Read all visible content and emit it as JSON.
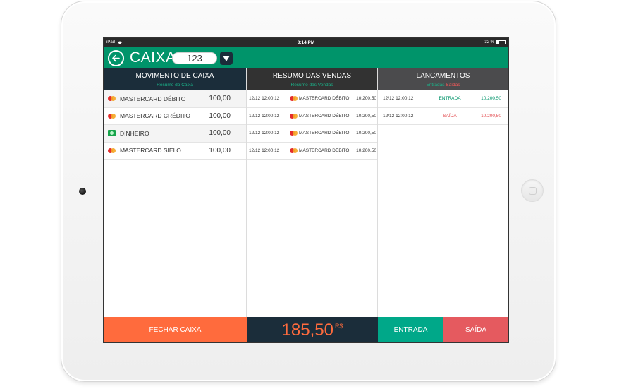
{
  "status_bar": {
    "carrier": "iPad",
    "time": "3:14 PM",
    "battery": "32 %"
  },
  "header": {
    "title": "CAIXA",
    "caixa_number": "123"
  },
  "movimento": {
    "title": "MOVIMENTO DE CAIXA",
    "subtitle": "Resumo do Caixa",
    "items": [
      {
        "icon": "mastercard-icon",
        "label": "MASTERCARD DÉBITO",
        "value": "100,00"
      },
      {
        "icon": "mastercard-icon",
        "label": "MASTERCARD CRÉDITO",
        "value": "100,00"
      },
      {
        "icon": "cash-icon",
        "label": "DINHEIRO",
        "value": "100,00"
      },
      {
        "icon": "mastercard-icon",
        "label": "MASTERCARD SIELO",
        "value": "100,00"
      }
    ]
  },
  "vendas": {
    "title": "RESUMO DAS VENDAS",
    "subtitle": "Resumo das Vendas",
    "items": [
      {
        "date": "12/12 12:00:12",
        "card": "MASTERCARD DÉBITO",
        "amount": "10.200,50"
      },
      {
        "date": "12/12 12:00:12",
        "card": "MASTERCARD DÉBITO",
        "amount": "10.200,50"
      },
      {
        "date": "12/12 12:00:12",
        "card": "MASTERCARD DÉBITO",
        "amount": "10.200,50"
      },
      {
        "date": "12/12 12:00:12",
        "card": "MASTERCARD DÉBITO",
        "amount": "10.200,50"
      }
    ]
  },
  "lancamentos": {
    "title": "LANCAMENTOS",
    "sub_entradas": "Entradas",
    "sub_saidas": "Saídas",
    "items": [
      {
        "date": "12/12 12:00:12",
        "type": "ENTRADA",
        "amount": "10.200,50"
      },
      {
        "date": "12/12 12:00:12",
        "type": "SAÍDA",
        "amount": "-10.200,50"
      }
    ]
  },
  "footer": {
    "fechar_label": "FECHAR CAIXA",
    "total": "185,50",
    "currency": "R$",
    "entrada_label": "ENTRADA",
    "saida_label": "SAÍDA"
  },
  "colors": {
    "green": "#00946a",
    "navy": "#1b2d3a",
    "orange": "#ff6b3d",
    "red": "#e55a5f",
    "teal": "#00a889"
  }
}
